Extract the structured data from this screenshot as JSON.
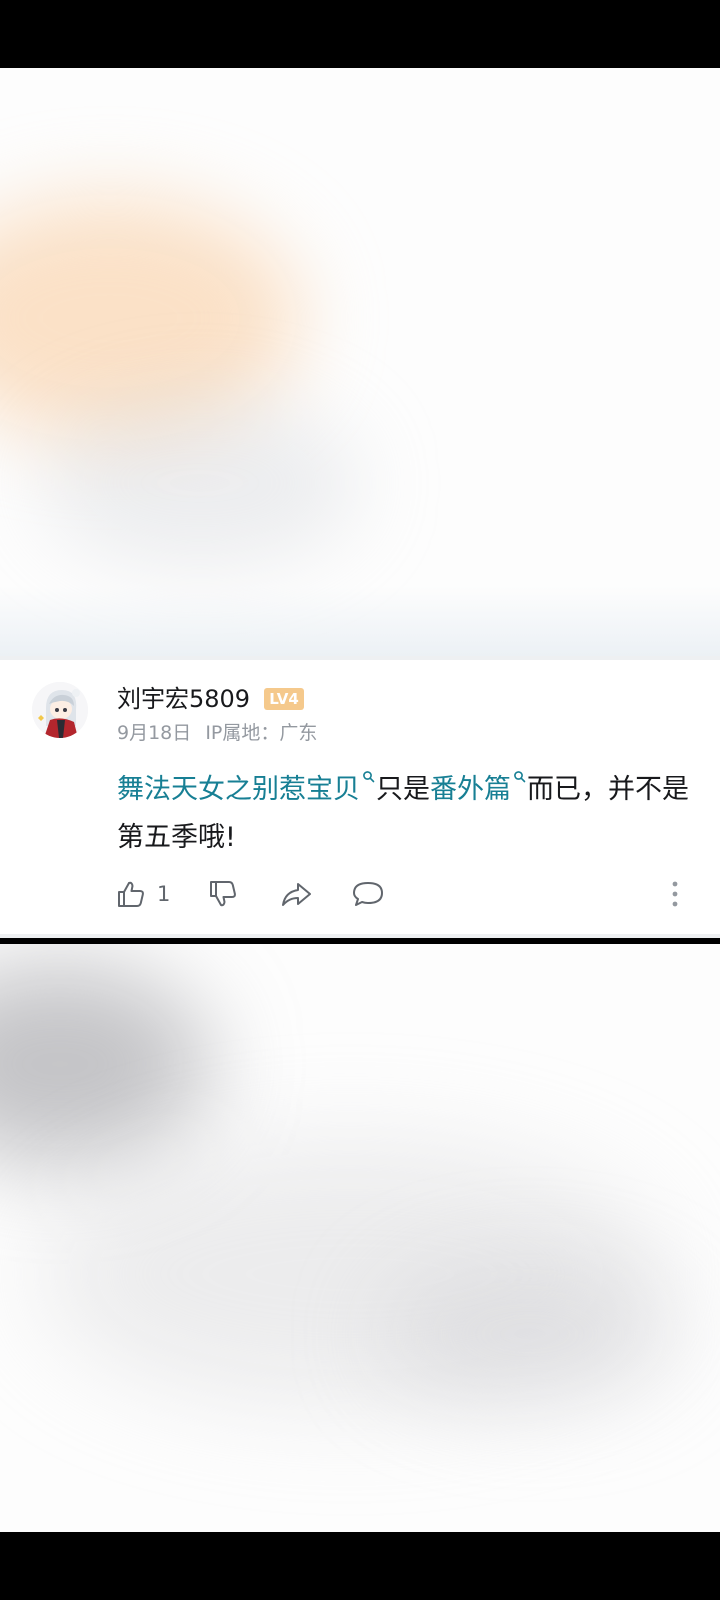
{
  "comment": {
    "username": "刘宇宏5809",
    "level": "LV4",
    "date": "9月18日",
    "ip_location": "IP属地：广东",
    "text_segments": [
      {
        "text": "舞法天女之别惹宝贝",
        "type": "keyword"
      },
      {
        "text": "只是",
        "type": "plain"
      },
      {
        "text": "番外篇",
        "type": "keyword"
      },
      {
        "text": "而已，并不是第五季哦!",
        "type": "plain"
      }
    ],
    "like_count": "1"
  },
  "colors": {
    "keyword": "#177f94",
    "level_badge": "#f5c98c",
    "meta": "#9499a0",
    "text": "#18191c"
  },
  "icons": {
    "like": "thumbs-up-icon",
    "dislike": "thumbs-down-icon",
    "share": "share-icon",
    "reply": "comment-bubble-icon",
    "more": "more-vertical-icon",
    "keyword_search": "search-icon"
  }
}
